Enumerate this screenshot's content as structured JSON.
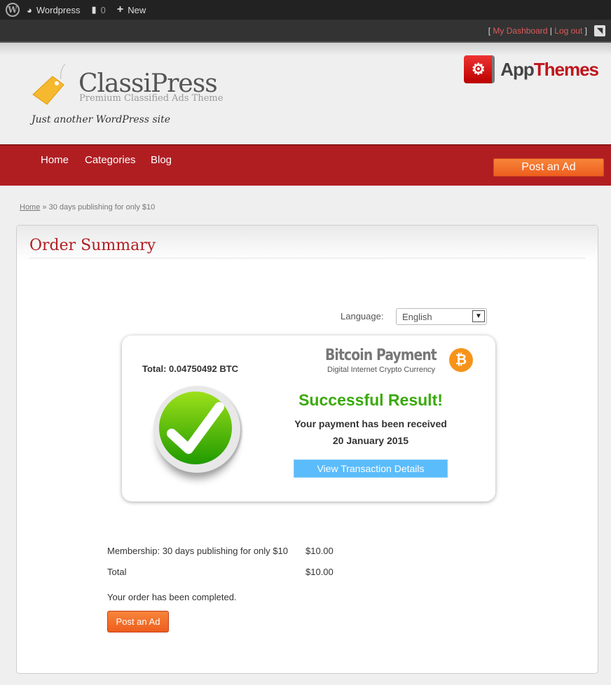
{
  "adminbar": {
    "site": "Wordpress",
    "comments": "0",
    "new": "New"
  },
  "topbar": {
    "open": "[",
    "dashboard": "My Dashboard",
    "sep": "|",
    "logout": "Log out",
    "close": "]"
  },
  "header": {
    "logo": "ClassiPress",
    "subtitle": "Premium Classified Ads Theme",
    "tagline": "Just another WordPress site",
    "brand_app": "App",
    "brand_themes": "Themes"
  },
  "nav": {
    "items": [
      "Home",
      "Categories",
      "Blog"
    ],
    "post_ad": "Post an Ad"
  },
  "breadcrumb": {
    "home": "Home",
    "current": "» 30 days publishing for only $10"
  },
  "order": {
    "title": "Order Summary",
    "language_label": "Language:",
    "language_value": "English",
    "payment": {
      "total": "Total: 0.04750492 BTC",
      "brand": "Bitcoin Payment",
      "brand_sub": "Digital Internet Crypto Currency",
      "result": "Successful Result!",
      "received": "Your payment has been received",
      "date": "20 January 2015",
      "details_button": "View Transaction Details"
    },
    "rows": [
      {
        "label": "Membership: 30 days publishing for only $10",
        "amount": "$10.00"
      },
      {
        "label": "Total",
        "amount": "$10.00"
      }
    ],
    "completed": "Your order has been completed.",
    "post_ad": "Post an Ad"
  },
  "colors": {
    "accent": "#b01e22",
    "success": "#3aa90c",
    "button": "#ee5e1e",
    "link_button": "#5bbcfb"
  }
}
